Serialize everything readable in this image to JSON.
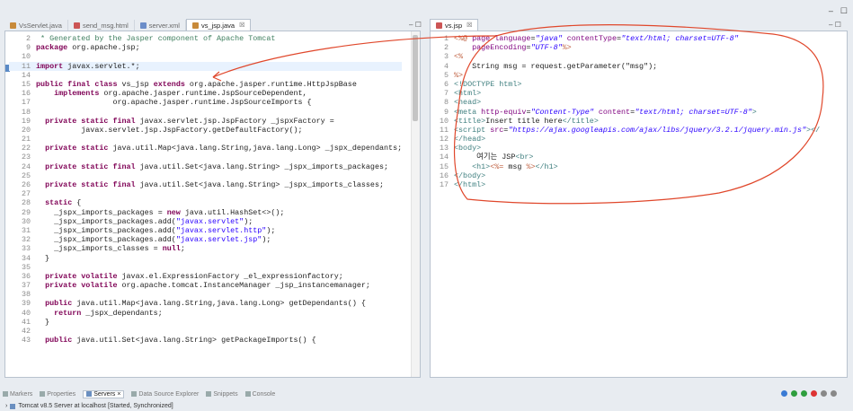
{
  "editor_tabs": [
    {
      "label": "VsServlet.java",
      "icon": "java-file-icon"
    },
    {
      "label": "send_msg.html",
      "icon": "html-file-icon"
    },
    {
      "label": "server.xml",
      "icon": "xml-file-icon"
    },
    {
      "label": "vs_jsp.java",
      "icon": "java-file-icon",
      "close": "☒"
    }
  ],
  "right_tab": {
    "label": "vs.jsp",
    "close": "☒"
  },
  "java_lines": [
    {
      "n": "2",
      "html": "<span class='cm'> * Generated by the Jasper component of Apache Tomcat</span>"
    },
    {
      "n": "9",
      "html": "<span class='kw'>package</span> org.apache.jsp;"
    },
    {
      "n": "10",
      "html": ""
    },
    {
      "n": "11",
      "html": "<span class='kw'>import</span> javax.servlet.*;",
      "hl": true
    },
    {
      "n": "14",
      "html": ""
    },
    {
      "n": "15",
      "html": "<span class='kw'>public final class</span> vs_jsp <span class='kw'>extends</span> org.apache.jasper.runtime.HttpJspBase"
    },
    {
      "n": "16",
      "html": "    <span class='kw'>implements</span> org.apache.jasper.runtime.JspSourceDependent,"
    },
    {
      "n": "17",
      "html": "                 org.apache.jasper.runtime.JspSourceImports {"
    },
    {
      "n": "18",
      "html": ""
    },
    {
      "n": "19",
      "html": "  <span class='kw'>private static final</span> javax.servlet.jsp.JspFactory _jspxFactory ="
    },
    {
      "n": "20",
      "html": "          javax.servlet.jsp.JspFactory.getDefaultFactory();"
    },
    {
      "n": "21",
      "html": ""
    },
    {
      "n": "22",
      "html": "  <span class='kw'>private static</span> java.util.Map&lt;java.lang.String,java.lang.Long&gt; _jspx_dependants;"
    },
    {
      "n": "23",
      "html": ""
    },
    {
      "n": "24",
      "html": "  <span class='kw'>private static final</span> java.util.Set&lt;java.lang.String&gt; _jspx_imports_packages;"
    },
    {
      "n": "25",
      "html": ""
    },
    {
      "n": "26",
      "html": "  <span class='kw'>private static final</span> java.util.Set&lt;java.lang.String&gt; _jspx_imports_classes;"
    },
    {
      "n": "27",
      "html": ""
    },
    {
      "n": "28",
      "html": "  <span class='kw'>static</span> {"
    },
    {
      "n": "29",
      "html": "    _jspx_imports_packages = <span class='kw'>new</span> java.util.HashSet&lt;&gt;();"
    },
    {
      "n": "30",
      "html": "    _jspx_imports_packages.add(<span class='str'>\"javax.servlet\"</span>);"
    },
    {
      "n": "31",
      "html": "    _jspx_imports_packages.add(<span class='str'>\"javax.servlet.http\"</span>);"
    },
    {
      "n": "32",
      "html": "    _jspx_imports_packages.add(<span class='str'>\"javax.servlet.jsp\"</span>);"
    },
    {
      "n": "33",
      "html": "    _jspx_imports_classes = <span class='kw'>null</span>;"
    },
    {
      "n": "34",
      "html": "  }"
    },
    {
      "n": "35",
      "html": ""
    },
    {
      "n": "36",
      "html": "  <span class='kw'>private volatile</span> javax.el.ExpressionFactory _el_expressionfactory;"
    },
    {
      "n": "37",
      "html": "  <span class='kw'>private volatile</span> org.apache.tomcat.InstanceManager _jsp_instancemanager;"
    },
    {
      "n": "38",
      "html": ""
    },
    {
      "n": "39",
      "html": "  <span class='kw'>public</span> java.util.Map&lt;java.lang.String,java.lang.Long&gt; getDependants() {"
    },
    {
      "n": "40",
      "html": "    <span class='kw'>return</span> _jspx_dependants;"
    },
    {
      "n": "41",
      "html": "  }"
    },
    {
      "n": "42",
      "html": ""
    },
    {
      "n": "43",
      "html": "  <span class='kw'>public</span> java.util.Set&lt;java.lang.String&gt; getPackageImports() {"
    }
  ],
  "jsp_lines": [
    {
      "n": "1",
      "html": "<span class='jsp'>&lt;%@</span> <span class='attr'>page</span> <span class='attr'>language</span>=<span class='aval'>\"java\"</span> <span class='attr'>contentType</span>=<span class='aval'>\"text/html; charset=UTF-8\"</span>"
    },
    {
      "n": "2",
      "html": "    <span class='attr'>pageEncoding</span>=<span class='aval'>\"UTF-8\"</span><span class='jsp'>%&gt;</span>"
    },
    {
      "n": "3",
      "html": "<span class='jsp'>&lt;%</span>"
    },
    {
      "n": "4",
      "html": "    String msg = request.getParameter(\"msg\");"
    },
    {
      "n": "5",
      "html": "<span class='jsp'>%&gt;</span>"
    },
    {
      "n": "6",
      "html": "<span class='tag'>&lt;!DOCTYPE html&gt;</span>"
    },
    {
      "n": "7",
      "html": "<span class='tag'>&lt;html&gt;</span>"
    },
    {
      "n": "8",
      "html": "<span class='tag'>&lt;head&gt;</span>"
    },
    {
      "n": "9",
      "html": "<span class='tag'>&lt;meta</span> <span class='attr'>http-equiv</span>=<span class='aval'>\"Content-Type\"</span> <span class='attr'>content</span>=<span class='aval'>\"text/html; charset=UTF-8\"</span><span class='tag'>&gt;</span>"
    },
    {
      "n": "10",
      "html": "<span class='tag'>&lt;title&gt;</span>Insert title here<span class='tag'>&lt;/title&gt;</span>"
    },
    {
      "n": "11",
      "html": "<span class='tag'>&lt;script</span> <span class='attr'>src</span>=<span class='aval'>\"https://ajax.googleapis.com/ajax/libs/jquery/3.2.1/jquery.min.js\"</span><span class='tag'>&gt;&lt;/</span>"
    },
    {
      "n": "12",
      "html": "<span class='tag'>&lt;/head&gt;</span>"
    },
    {
      "n": "13",
      "html": "<span class='tag'>&lt;body&gt;</span>"
    },
    {
      "n": "14",
      "html": "     여기는 JSP<span class='tag'>&lt;br&gt;</span>"
    },
    {
      "n": "15",
      "html": "    <span class='tag'>&lt;h1&gt;</span><span class='jsp'>&lt;%=</span> msg <span class='jsp'>%&gt;</span><span class='tag'>&lt;/h1&gt;</span>"
    },
    {
      "n": "16",
      "html": "<span class='tag'>&lt;/body&gt;</span>"
    },
    {
      "n": "17",
      "html": "<span class='tag'>&lt;/html&gt;</span>"
    }
  ],
  "bottom_tabs": [
    {
      "label": "Markers"
    },
    {
      "label": "Properties"
    },
    {
      "label": "Servers",
      "active": true
    },
    {
      "label": "Data Source Explorer"
    },
    {
      "label": "Snippets"
    },
    {
      "label": "Console"
    }
  ],
  "server_entry": "Tomcat v8.5 Server at localhost  [Started, Synchronized]",
  "colors": {
    "annotation_red": "#e0472b"
  }
}
